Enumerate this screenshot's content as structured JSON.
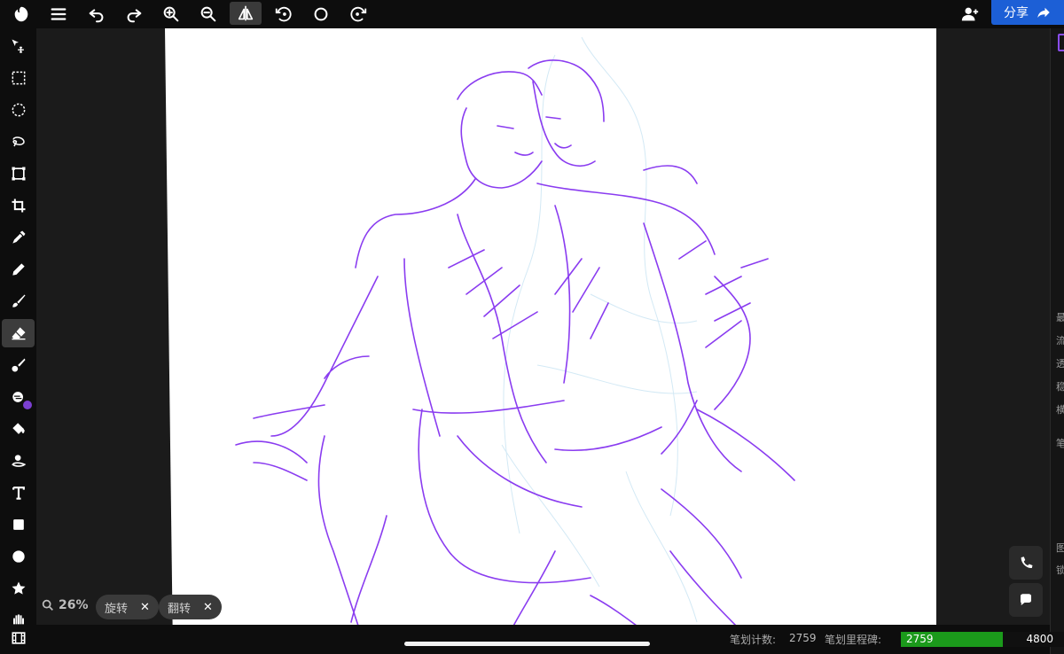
{
  "toolbar": {
    "items": [
      {
        "name": "logo-icon"
      },
      {
        "name": "menu-icon"
      },
      {
        "name": "undo-icon"
      },
      {
        "name": "redo-icon"
      },
      {
        "name": "zoom-in-icon"
      },
      {
        "name": "zoom-out-icon"
      },
      {
        "name": "symmetry-icon"
      },
      {
        "name": "rotate-left-icon"
      },
      {
        "name": "reset-rotation-icon"
      },
      {
        "name": "rotate-right-icon"
      }
    ],
    "share_label": "分享",
    "add_user_icon": "add-user-icon",
    "share_icon": "share-arrow-icon"
  },
  "tools": [
    {
      "name": "move-tool",
      "icon": "move-icon"
    },
    {
      "name": "rect-select-tool",
      "icon": "rect-select-icon"
    },
    {
      "name": "ellipse-select-tool",
      "icon": "ellipse-select-icon"
    },
    {
      "name": "lasso-tool",
      "icon": "lasso-icon"
    },
    {
      "name": "transform-tool",
      "icon": "transform-icon"
    },
    {
      "name": "crop-tool",
      "icon": "crop-icon"
    },
    {
      "name": "eyedropper-tool",
      "icon": "eyedropper-icon"
    },
    {
      "name": "pencil-tool",
      "icon": "pencil-icon"
    },
    {
      "name": "brush-tool",
      "icon": "brush-icon"
    },
    {
      "name": "eraser-tool",
      "icon": "eraser-icon",
      "active": true
    },
    {
      "name": "blur-tool",
      "icon": "blur-icon"
    },
    {
      "name": "smudge-tool",
      "icon": "smudge-icon"
    },
    {
      "name": "fill-tool",
      "icon": "paint-bucket-icon"
    },
    {
      "name": "clone-tool",
      "icon": "clone-icon"
    },
    {
      "name": "text-tool",
      "icon": "text-icon"
    },
    {
      "name": "rectangle-tool",
      "icon": "square-icon"
    },
    {
      "name": "ellipse-tool",
      "icon": "circle-icon"
    },
    {
      "name": "shape-tool",
      "icon": "star-icon"
    },
    {
      "name": "hand-tool",
      "icon": "hand-icon"
    },
    {
      "name": "film-tool",
      "icon": "film-icon"
    }
  ],
  "colors": {
    "accent": "#1c5fd6",
    "brush": "#7b3fd1",
    "progress": "#1b9a1b",
    "stroke": "#8a3cf0",
    "sketch_light": "#cfe6f3"
  },
  "zoom": {
    "value": "26%"
  },
  "chips": [
    {
      "label": "旋转"
    },
    {
      "label": "翻转"
    }
  ],
  "chip_close": "✕",
  "status": {
    "stroke_count_label": "笔划计数:",
    "stroke_count": "2759",
    "milestone_label": "笔划里程碑:",
    "milestone_value": "2759",
    "milestone_max": "4800",
    "milestone_fraction": 0.575
  },
  "right_panel": {
    "labels": [
      "最",
      "流",
      "透",
      "稳",
      "横",
      "笔",
      "图",
      "锁"
    ]
  }
}
